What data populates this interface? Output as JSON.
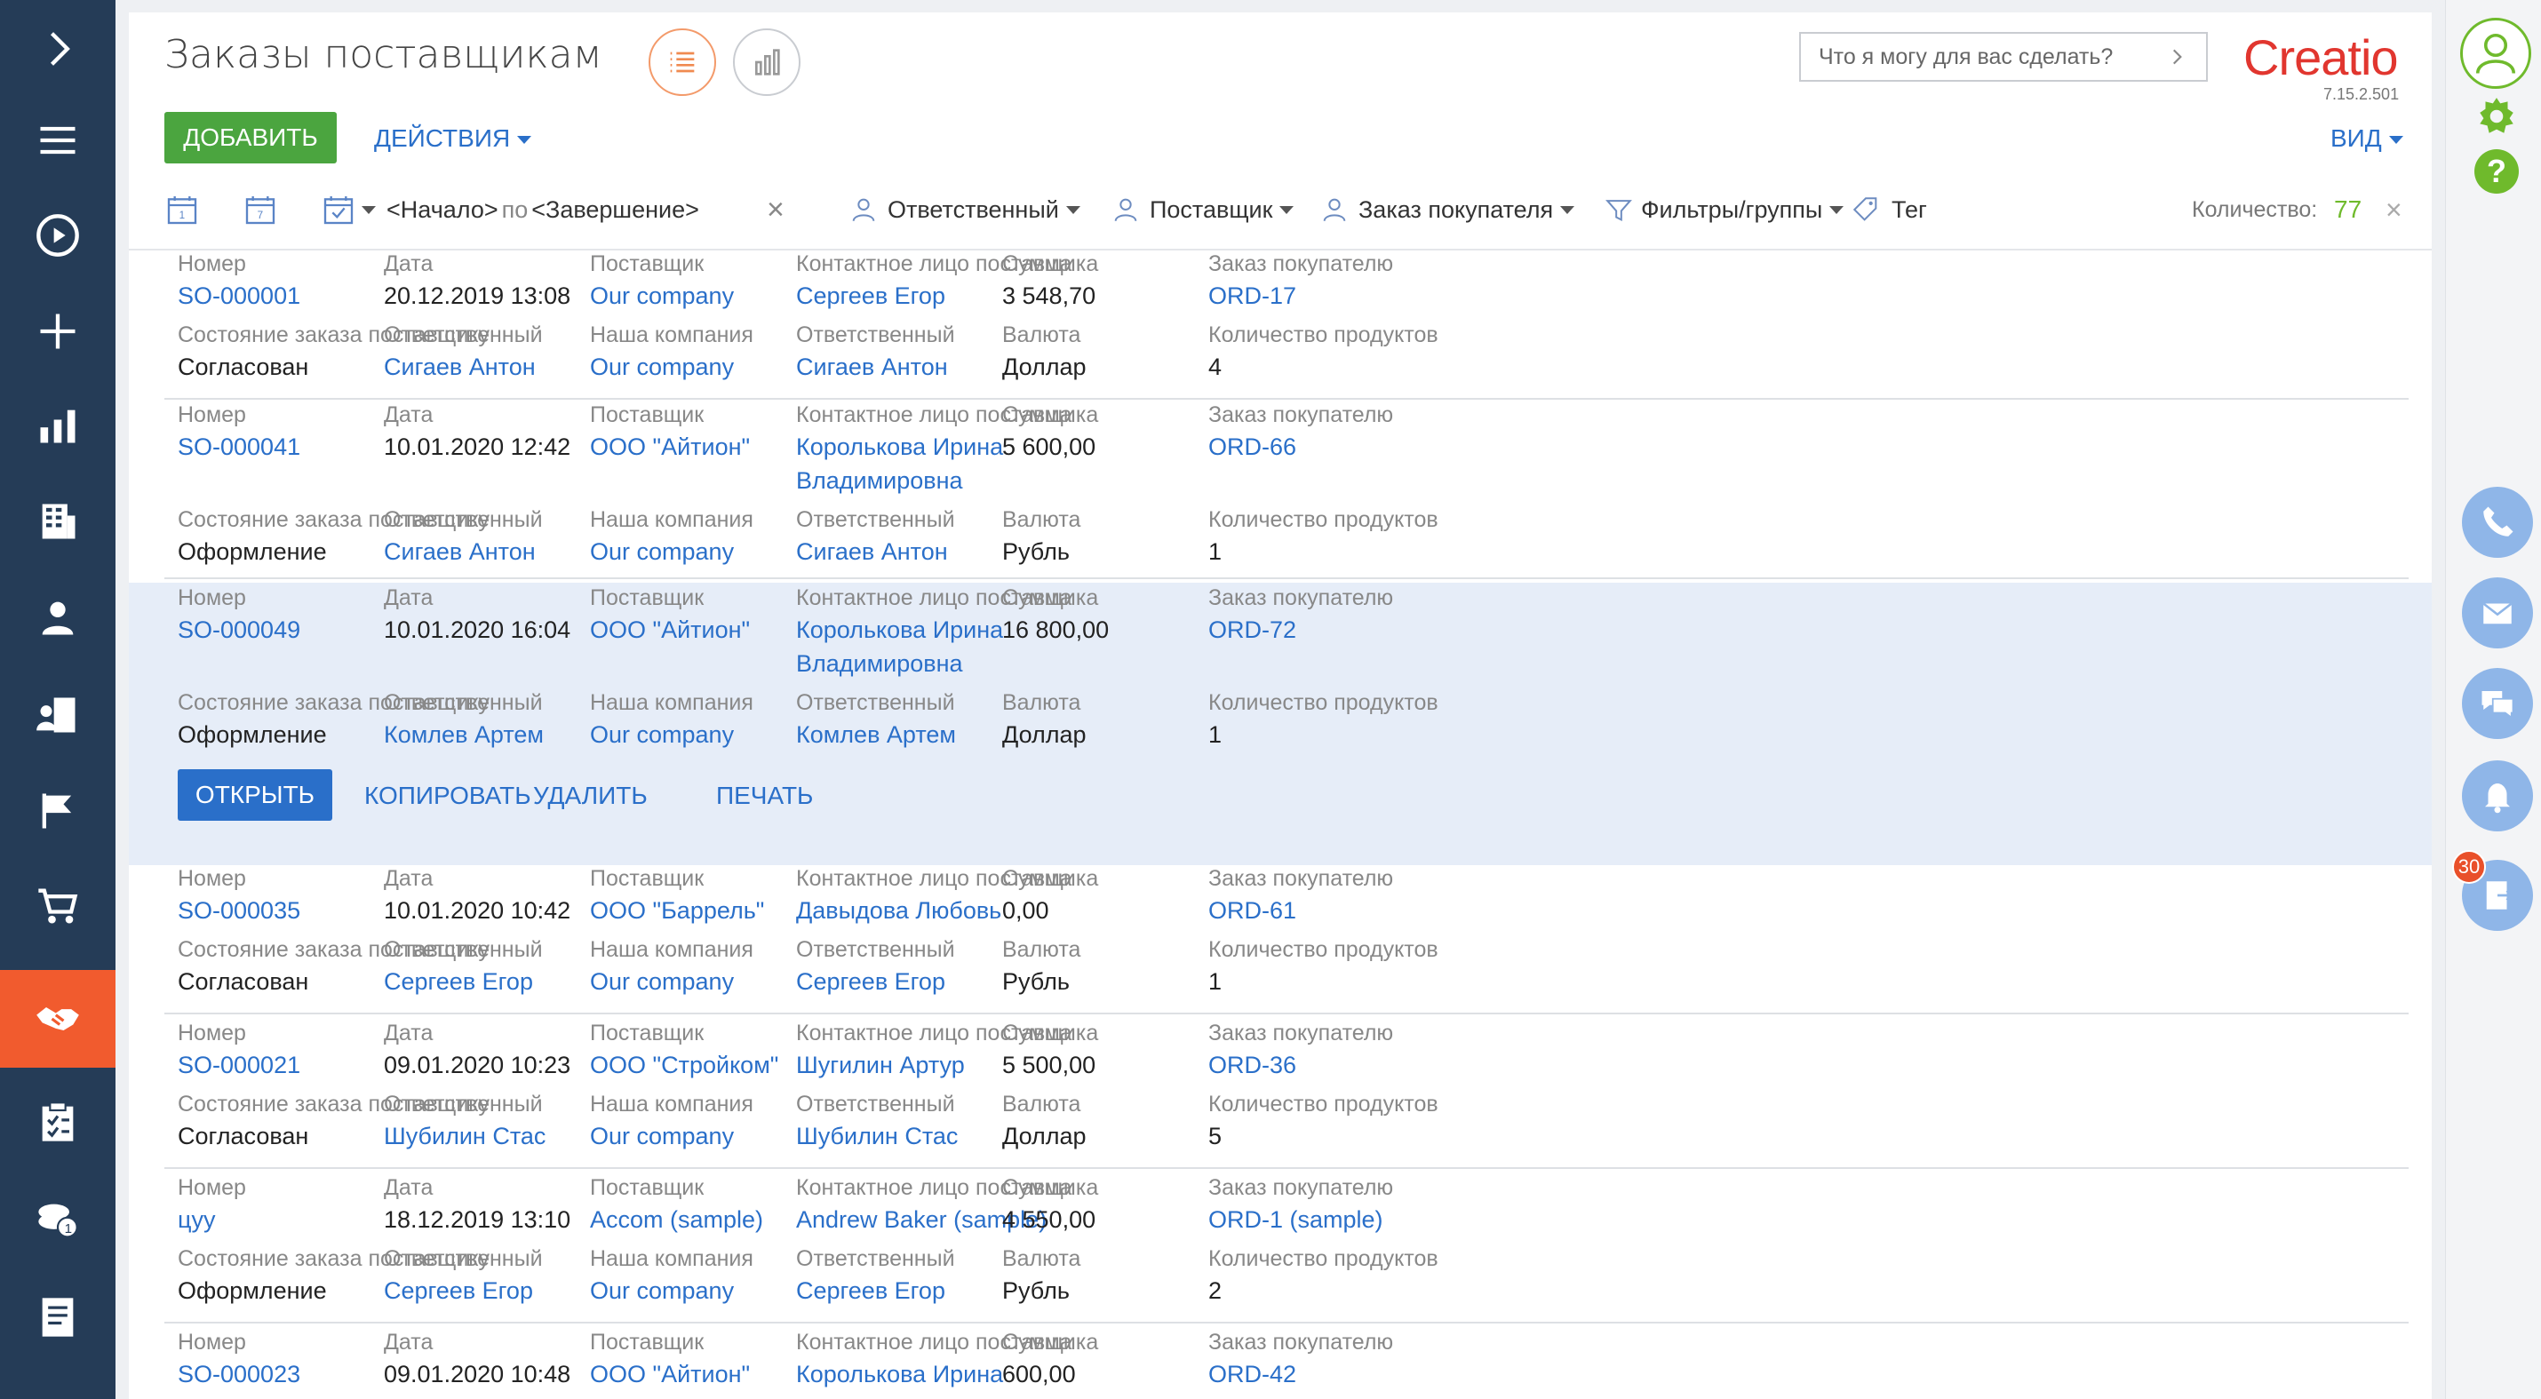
{
  "page": {
    "title": "Заказы поставщикам",
    "add_label": "ДОБАВИТЬ",
    "actions_label": "ДЕЙСТВИЯ",
    "view_label": "ВИД",
    "search_placeholder": "Что я могу для вас сделать?",
    "logo_text": "Creatio",
    "version": "7.15.2.501"
  },
  "filters": {
    "date_start": "<Начало>",
    "date_by": "по",
    "date_end": "<Завершение>",
    "owner": "Ответственный",
    "supplier": "Поставщик",
    "customer_order": "Заказ покупателя",
    "filters_groups": "Фильтры/группы",
    "tag": "Тег",
    "count_label": "Количество:",
    "count_value": "77"
  },
  "labels": {
    "number": "Номер",
    "date": "Дата",
    "supplier": "Поставщик",
    "contact": "Контактное лицо поставщика",
    "amount": "Сумма",
    "customer_order": "Заказ покупателю",
    "state": "Состояние заказа поставщику",
    "owner": "Ответственный",
    "our_company": "Наша компания",
    "contact_owner": "Ответственный",
    "currency": "Валюта",
    "product_count": "Количество продуктов"
  },
  "record_actions": {
    "open": "ОТКРЫТЬ",
    "copy": "КОПИРОВАТЬ",
    "delete": "УДАЛИТЬ",
    "print": "ПЕЧАТЬ"
  },
  "records": [
    {
      "number": "SO-000001",
      "date": "20.12.2019 13:08",
      "supplier": "Our company",
      "contact": "Сергеев Егор",
      "amount": "3 548,70",
      "customer_order": "ORD-17",
      "state": "Согласован",
      "owner": "Сигаев Антон",
      "our_company": "Our company",
      "contact_owner": "Сигаев Антон",
      "currency": "Доллар",
      "product_count": "4"
    },
    {
      "number": "SO-000041",
      "date": "10.01.2020 12:42",
      "supplier": "ООО \"Айтион\"",
      "contact": "Королькова Ирина Владимировна",
      "amount": "5 600,00",
      "customer_order": "ORD-66",
      "state": "Оформление",
      "owner": "Сигаев Антон",
      "our_company": "Our company",
      "contact_owner": "Сигаев Антон",
      "currency": "Рубль",
      "product_count": "1"
    },
    {
      "number": "SO-000049",
      "date": "10.01.2020 16:04",
      "supplier": "ООО \"Айтион\"",
      "contact": "Королькова Ирина Владимировна",
      "amount": "16 800,00",
      "customer_order": "ORD-72",
      "state": "Оформление",
      "owner": "Комлев Артем",
      "our_company": "Our company",
      "contact_owner": "Комлев Артем",
      "currency": "Доллар",
      "product_count": "1"
    },
    {
      "number": "SO-000035",
      "date": "10.01.2020 10:42",
      "supplier": "ООО \"Баррель\"",
      "contact": "Давыдова Любовь",
      "amount": "0,00",
      "customer_order": "ORD-61",
      "state": "Согласован",
      "owner": "Сергеев Егор",
      "our_company": "Our company",
      "contact_owner": "Сергеев Егор",
      "currency": "Рубль",
      "product_count": "1"
    },
    {
      "number": "SO-000021",
      "date": "09.01.2020 10:23",
      "supplier": "ООО \"Стройком\"",
      "contact": "Шугилин Артур",
      "amount": "5 500,00",
      "customer_order": "ORD-36",
      "state": "Согласован",
      "owner": "Шубилин Стас",
      "our_company": "Our company",
      "contact_owner": "Шубилин Стас",
      "currency": "Доллар",
      "product_count": "5"
    },
    {
      "number": "цуу",
      "date": "18.12.2019 13:10",
      "supplier": "Accom (sample)",
      "contact": "Andrew Baker (sample)",
      "amount": "4 550,00",
      "customer_order": "ORD-1 (sample)",
      "state": "Оформление",
      "owner": "Сергеев Егор",
      "our_company": "Our company",
      "contact_owner": "Сергеев Егор",
      "currency": "Рубль",
      "product_count": "2"
    },
    {
      "number": "SO-000023",
      "date": "09.01.2020 10:48",
      "supplier": "ООО \"Айтион\"",
      "contact": "Королькова Ирина",
      "amount": "600,00",
      "customer_order": "ORD-42"
    }
  ],
  "rightbar": {
    "notifications_count": "30"
  },
  "colors": {
    "nav_bg": "#253c57",
    "nav_active": "#f15b2e",
    "add_green": "#4ba53f",
    "link_blue": "#2a6fc9",
    "selected_row": "#e6edf8"
  }
}
